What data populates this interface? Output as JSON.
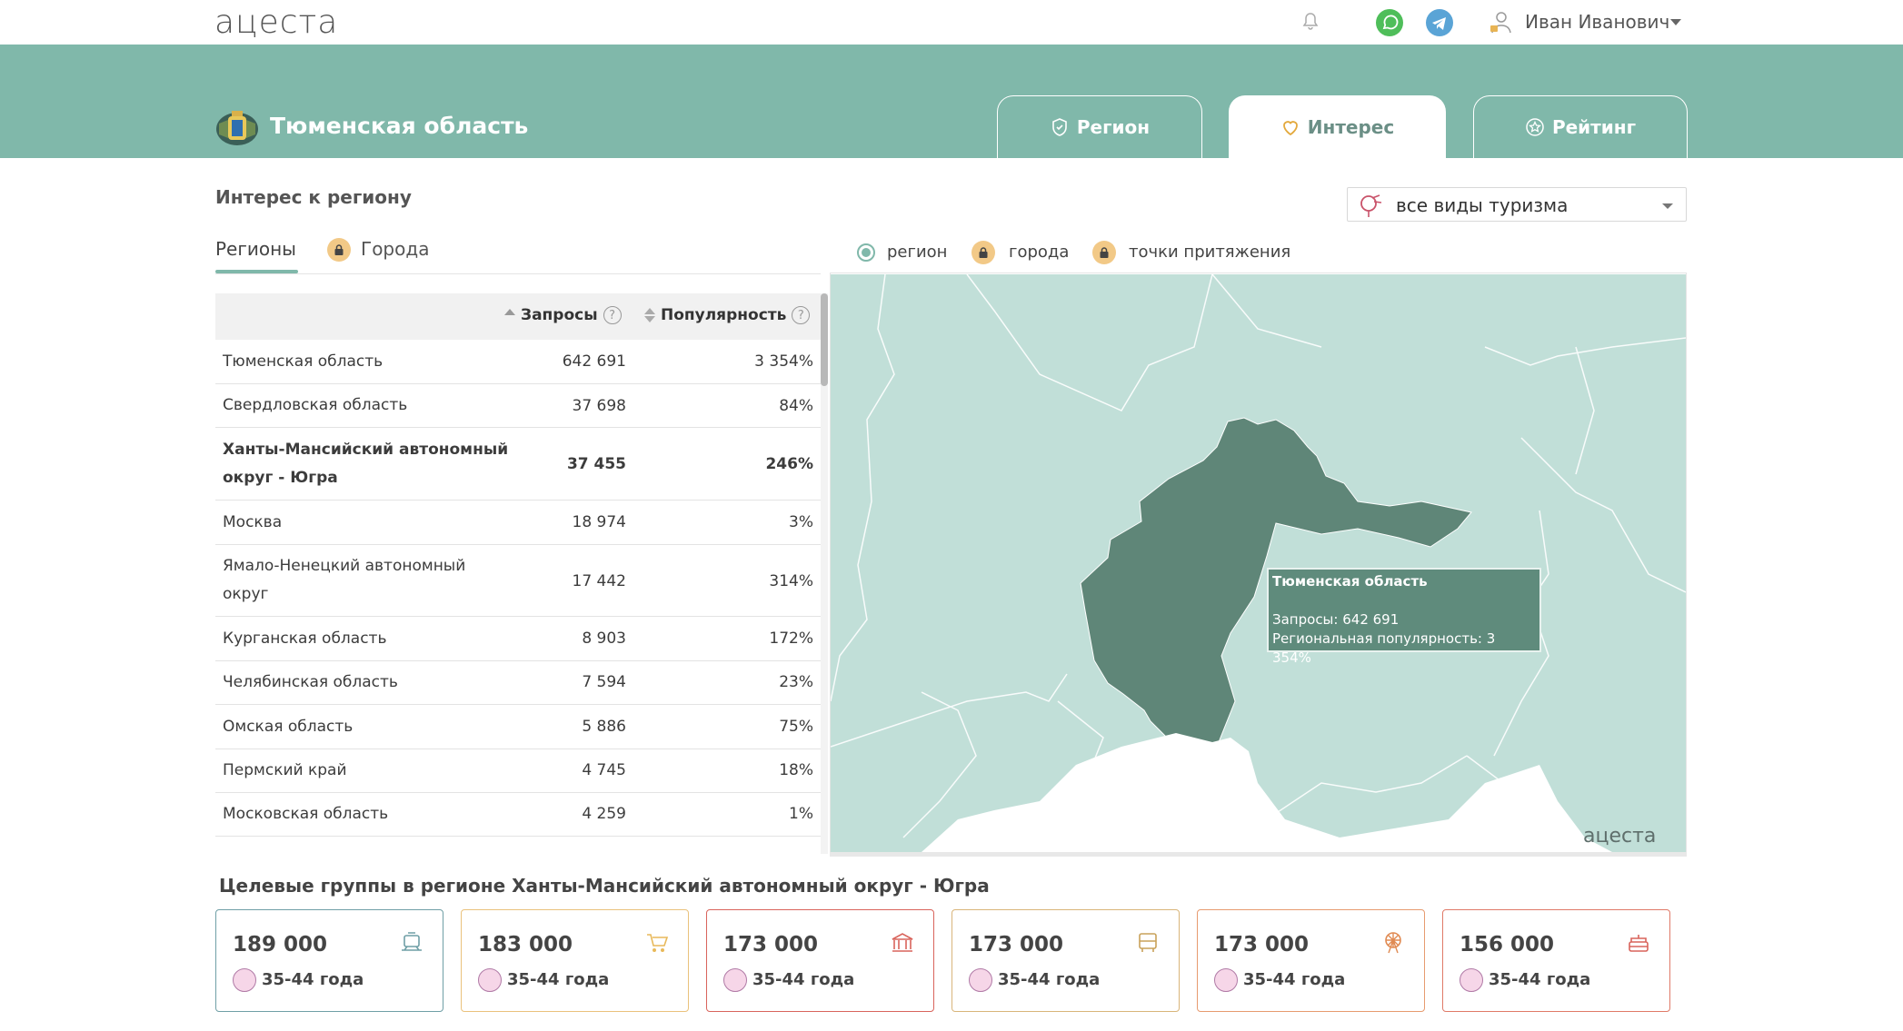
{
  "header": {
    "logo": "ацеста",
    "user_name": "Иван Иванович"
  },
  "region": {
    "title": "Тюменская область"
  },
  "tabs": [
    {
      "label": "Регион",
      "icon": "shield-icon",
      "active": false
    },
    {
      "label": "Интерес",
      "icon": "heart-icon",
      "active": true
    },
    {
      "label": "Рейтинг",
      "icon": "star-icon",
      "active": false
    }
  ],
  "interest": {
    "title": "Интерес к региону",
    "tourism_select": "все виды туризма",
    "subtabs": {
      "regions": "Регионы",
      "cities": "Города"
    },
    "columns": {
      "requests": "Запросы",
      "popularity": "Популярность",
      "help": "?"
    },
    "rows": [
      {
        "name": "Тюменская область",
        "requests": "642 691",
        "popularity": "3 354%"
      },
      {
        "name": "Свердловская область",
        "requests": "37 698",
        "popularity": "84%"
      },
      {
        "name": "Ханты-Мансийский автономный округ - Югра",
        "requests": "37 455",
        "popularity": "246%"
      },
      {
        "name": "Москва",
        "requests": "18 974",
        "popularity": "3%"
      },
      {
        "name": "Ямало-Ненецкий автономный округ",
        "requests": "17 442",
        "popularity": "314%"
      },
      {
        "name": "Курганская область",
        "requests": "8 903",
        "popularity": "172%"
      },
      {
        "name": "Челябинская область",
        "requests": "7 594",
        "popularity": "23%"
      },
      {
        "name": "Омская область",
        "requests": "5 886",
        "popularity": "75%"
      },
      {
        "name": "Пермский край",
        "requests": "4 745",
        "popularity": "18%"
      },
      {
        "name": "Московская область",
        "requests": "4 259",
        "popularity": "1%"
      }
    ]
  },
  "map": {
    "legend": {
      "region": "регион",
      "cities": "города",
      "points": "точки притяжения"
    },
    "tooltip": {
      "title": "Тюменская область",
      "requests": "Запросы: 642 691",
      "popularity": "Региональная популярность: 3 354%"
    },
    "watermark": "ацеста"
  },
  "targets": {
    "title": "Целевые группы в регионе Ханты-Мансийский автономный округ - Югра",
    "cards": [
      {
        "value": "189 000",
        "age": "35-44 года",
        "icon": "train-icon",
        "color": "#6f9fa6"
      },
      {
        "value": "183 000",
        "age": "35-44 года",
        "icon": "cart-icon",
        "color": "#eac27c"
      },
      {
        "value": "173 000",
        "age": "35-44 года",
        "icon": "museum-icon",
        "color": "#d9645c"
      },
      {
        "value": "173 000",
        "age": "35-44 года",
        "icon": "bus-icon",
        "color": "#d9b57a"
      },
      {
        "value": "173 000",
        "age": "35-44 года",
        "icon": "ferris-wheel-icon",
        "color": "#e79b6f"
      },
      {
        "value": "156 000",
        "age": "35-44 года",
        "icon": "cake-icon",
        "color": "#e07a68"
      }
    ]
  }
}
